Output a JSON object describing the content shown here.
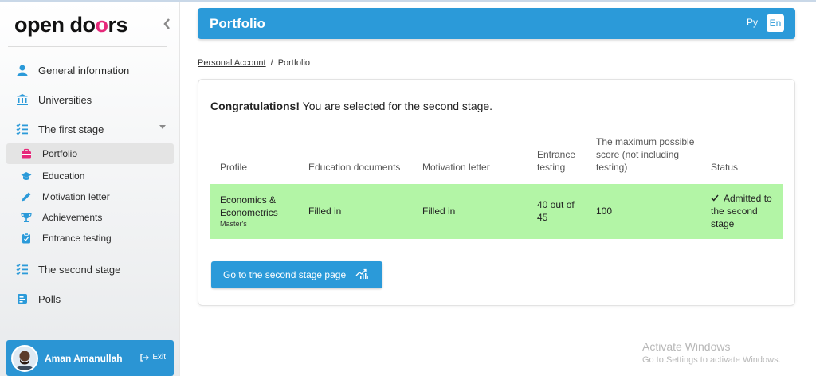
{
  "app": {
    "logo_part1": "open do",
    "logo_o": "o",
    "logo_part2": "rs"
  },
  "sidebar": {
    "items": [
      {
        "label": "General information",
        "icon": "user-icon"
      },
      {
        "label": "Universities",
        "icon": "university-icon"
      },
      {
        "label": "The first stage",
        "icon": "checklist-icon"
      },
      {
        "label": "The second stage",
        "icon": "checklist-icon"
      },
      {
        "label": "Polls",
        "icon": "poll-icon"
      }
    ],
    "sub_items": [
      {
        "label": "Portfolio",
        "icon": "briefcase-icon",
        "active": true
      },
      {
        "label": "Education",
        "icon": "graduation-cap-icon"
      },
      {
        "label": "Motivation letter",
        "icon": "pen-icon"
      },
      {
        "label": "Achievements",
        "icon": "trophy-icon"
      },
      {
        "label": "Entrance testing",
        "icon": "clipboard-icon"
      }
    ]
  },
  "user": {
    "name": "Aman Amanullah",
    "exit_label": "Exit"
  },
  "header": {
    "title": "Portfolio",
    "lang_ru": "Ру",
    "lang_en": "En"
  },
  "breadcrumb": {
    "link": "Personal Account",
    "separator": "/",
    "current": "Portfolio"
  },
  "main": {
    "congrats_bold": "Congratulations!",
    "congrats_text": " You are selected for the second stage.",
    "table": {
      "headers": [
        "Profile",
        "Education documents",
        "Motivation letter",
        "Entrance testing",
        "The maximum possible score (not including testing)",
        "Status"
      ],
      "row": {
        "profile": "Economics & Econometrics",
        "profile_sub": "Master's",
        "education": "Filled in",
        "motivation": "Filled in",
        "testing": "40 out of 45",
        "max_score": "100",
        "status": "Admitted to the second stage"
      }
    },
    "button_label": "Go to the second stage page"
  },
  "watermark": {
    "title": "Activate Windows",
    "subtitle": "Go to Settings to activate Windows."
  },
  "colors": {
    "accent": "#2b9ad9",
    "brand_pink": "#e6297a",
    "success_row": "#b3f5a6"
  }
}
